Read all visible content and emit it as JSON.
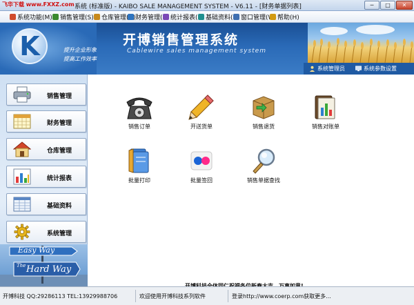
{
  "window": {
    "site_badge": "飞华下载 www.FXXZ.com",
    "title": "系统 (标准版) - KAIBO SALE MANAGEMENT SYSTEM - V6.11 - [财务单据列表]",
    "min_label": "─",
    "max_label": "□",
    "close_label": "✕"
  },
  "menu": [
    {
      "label": "系统功能(M)",
      "icon": "system-icon",
      "color": "#d04a2b"
    },
    {
      "label": "销售管理(S)",
      "icon": "sales-icon",
      "color": "#3b8a2f"
    },
    {
      "label": "仓库管理(C)",
      "icon": "warehouse-icon",
      "color": "#c88a1d"
    },
    {
      "label": "财务管理(F)",
      "icon": "finance-icon",
      "color": "#2e74c0"
    },
    {
      "label": "统计报表(R)",
      "icon": "report-icon",
      "color": "#7a49b6"
    },
    {
      "label": "基础资料(B)",
      "icon": "basic-data-icon",
      "color": "#1f8f8f"
    },
    {
      "label": "窗口管理(W)",
      "icon": "window-icon",
      "color": "#3f6fb0"
    },
    {
      "label": "帮助(H)",
      "icon": "help-icon",
      "color": "#d19a12"
    }
  ],
  "banner": {
    "logo_letter": "K",
    "slogan_1": "提升企业形象",
    "slogan_2": "提高工作效率",
    "title": "开博销售管理系统",
    "subtitle": "Cablewire sales management system",
    "user_label": "系统管理员",
    "settings_label": "系统参数设置"
  },
  "sidebar": [
    {
      "label": "销售管理",
      "icon": "printer-icon"
    },
    {
      "label": "财务管理",
      "icon": "calendar-grid-icon"
    },
    {
      "label": "仓库管理",
      "icon": "house-icon"
    },
    {
      "label": "统计报表",
      "icon": "bar-chart-icon"
    },
    {
      "label": "基础资料",
      "icon": "data-grid-icon"
    },
    {
      "label": "系统管理",
      "icon": "gear-icon"
    }
  ],
  "sidebar_footer": {
    "sign_1": "Easy Way",
    "sign_2": "The",
    "sign_3": "Hard Way"
  },
  "tiles": [
    {
      "label": "销售订单",
      "icon": "telephone-icon"
    },
    {
      "label": "开送货单",
      "icon": "pencil-icon"
    },
    {
      "label": "销售退货",
      "icon": "return-box-icon"
    },
    {
      "label": "销售对账单",
      "icon": "binder-chart-icon"
    },
    {
      "label": "批量打印",
      "icon": "folder-print-icon"
    },
    {
      "label": "批量签回",
      "icon": "dots-icon"
    },
    {
      "label": "销售单据查找",
      "icon": "magnifier-icon"
    }
  ],
  "news": "开博科技全体同仁祝福各位新春大吉，万事如意!",
  "status": {
    "contact": "开博科技 QQ:29286113 TEL:13929988706",
    "welcome": "欢迎使用开博科技系列软件",
    "login_info": "登录http://www.coerp.com获取更多..."
  }
}
